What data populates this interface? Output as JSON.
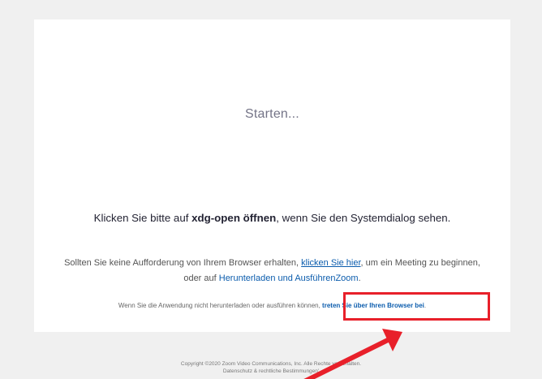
{
  "launch": {
    "status": "Starten...",
    "prompt_prefix": "Klicken Sie bitte auf ",
    "prompt_action": "xdg-open öffnen",
    "prompt_suffix": ", wenn Sie den Systemdialog sehen."
  },
  "fallback": {
    "line1_prefix": "Sollten Sie keine Aufforderung von Ihrem Browser erhalten, ",
    "click_here_link": "klicken Sie hier",
    "line1_suffix": ", um ein Meeting zu beginnen,",
    "line2_prefix": "oder auf ",
    "download_link": "Herunterladen und AusführenZoom",
    "line2_suffix": "."
  },
  "browser_join": {
    "prefix": "Wenn Sie die Anwendung nicht herunterladen oder ausführen können, ",
    "link": "treten Sie über Ihren Browser bei",
    "suffix": "."
  },
  "footer": {
    "copyright": "Copyright ©2020 Zoom Video Communications, Inc. Alle Rechte vorbehalten.",
    "legal": "Datenschutz & rechtliche Bestimmungen'"
  },
  "annotation": {
    "highlight_color": "#e8202a"
  }
}
